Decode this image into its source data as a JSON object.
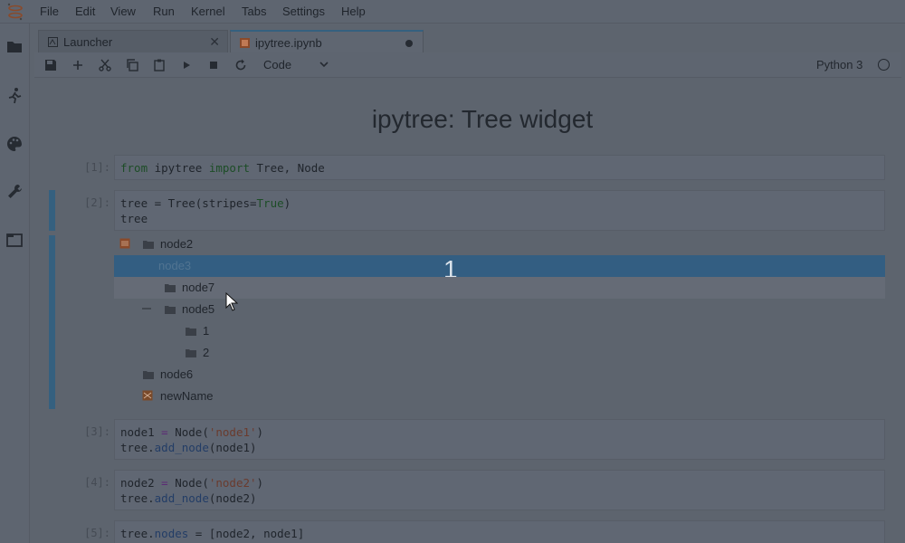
{
  "menubar": {
    "items": [
      "File",
      "Edit",
      "View",
      "Run",
      "Kernel",
      "Tabs",
      "Settings",
      "Help"
    ]
  },
  "sidebar": {
    "icons": [
      "folder-icon",
      "running-icon",
      "palette-icon",
      "wrench-icon",
      "tabs-icon"
    ]
  },
  "tabs": [
    {
      "label": "Launcher",
      "icon": "launcher-icon",
      "active": false
    },
    {
      "label": "ipytree.ipynb",
      "icon": "notebook-icon",
      "active": true
    }
  ],
  "toolbar": {
    "cell_type": "Code",
    "kernel_name": "Python 3"
  },
  "notebook": {
    "title": "ipytree: Tree widget",
    "cells": [
      {
        "prompt": "[1]:",
        "lines": [
          [
            "from",
            " ipytree ",
            "import",
            " Tree, Node"
          ]
        ]
      },
      {
        "prompt": "[2]:",
        "lines": [
          [
            "tree = Tree(stripes=",
            "True",
            ")"
          ],
          [
            "tree"
          ]
        ]
      },
      {
        "prompt": "[3]:",
        "lines": [
          [
            "node1 ",
            "=",
            " Node(",
            "'node1'",
            ")"
          ],
          [
            "tree.",
            "add_node",
            "(node1)"
          ]
        ]
      },
      {
        "prompt": "[4]:",
        "lines": [
          [
            "node2 ",
            "=",
            " Node(",
            "'node2'",
            ")"
          ],
          [
            "tree.",
            "add_node",
            "(node2)"
          ]
        ]
      },
      {
        "prompt": "[5]:",
        "lines": [
          [
            "tree.",
            "nodes",
            " = [node2, node1]"
          ]
        ]
      }
    ],
    "tree": {
      "nodes": [
        {
          "label": "node2"
        },
        {
          "label": "node3",
          "selected": true,
          "badge": "1"
        },
        {
          "label": "node7"
        },
        {
          "label": "node5"
        },
        {
          "label": "1"
        },
        {
          "label": "2"
        },
        {
          "label": "node6"
        },
        {
          "label": "newName"
        }
      ]
    }
  },
  "colors": {
    "accent": "#35607f",
    "selected_row": "#335e82",
    "background": "#5d646e"
  }
}
